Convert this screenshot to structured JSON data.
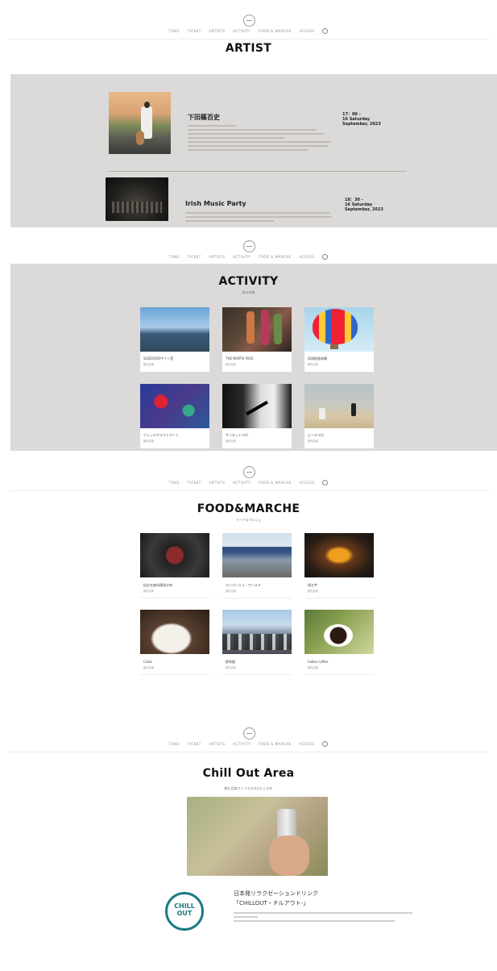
{
  "nav": {
    "links": [
      "TOKO",
      "TICKET",
      "ARTISTS",
      "ACTIVITY",
      "FOOD & MARCHE",
      "ACCESS"
    ]
  },
  "artist": {
    "title": "ARTIST",
    "items": [
      {
        "name": "下田篠百史",
        "time": "17：00 -",
        "date": "16 Saturday",
        "month": "September, 2023"
      },
      {
        "name": "Irish Music Party",
        "time": "18：30 -",
        "date": "16 Saturday",
        "month": "September, 2023"
      }
    ]
  },
  "activity": {
    "title": "ACTIVITY",
    "subtitle": "体の体験",
    "cards": [
      {
        "title": "SUDOOOOザイン室",
        "sub": "館内会場"
      },
      {
        "title": "THE NORTH FACE",
        "sub": "館内会場"
      },
      {
        "title": "気球絵画体験",
        "sub": "館内会場"
      },
      {
        "title": "ウィッチクラフトアート",
        "sub": "館内会場"
      },
      {
        "title": "サンセットヨガ",
        "sub": "館内会場"
      },
      {
        "title": "ビーチヨガ",
        "sub": "館内会場"
      }
    ]
  },
  "food": {
    "title": "FOOD&MARCHE",
    "subtitle": "フード＆マルシェ",
    "cards": [
      {
        "title": "仙台名産料理焼き肉",
        "sub": "館内会場"
      },
      {
        "title": "カンパーニュ・ワールド",
        "sub": "館内会場"
      },
      {
        "title": "焼き芋",
        "sub": "館内会場"
      },
      {
        "title": "Cubis",
        "sub": "館内会場"
      },
      {
        "title": "群馬屋",
        "sub": "館内会場"
      },
      {
        "title": "hakko coffee",
        "sub": "館内会場"
      }
    ]
  },
  "chill": {
    "title": "Chill Out Area",
    "subtitle": "飲む音楽でくつろぎのひとときを",
    "logo_text": [
      "CHILL",
      "OUT"
    ],
    "heading1": "日本発リラクゼーションドリンク",
    "heading2": "「CHILLOUT・チルアウト-」"
  },
  "colors": {
    "gray_band": "#dcdad8",
    "chill_teal": "#1a7a84"
  }
}
